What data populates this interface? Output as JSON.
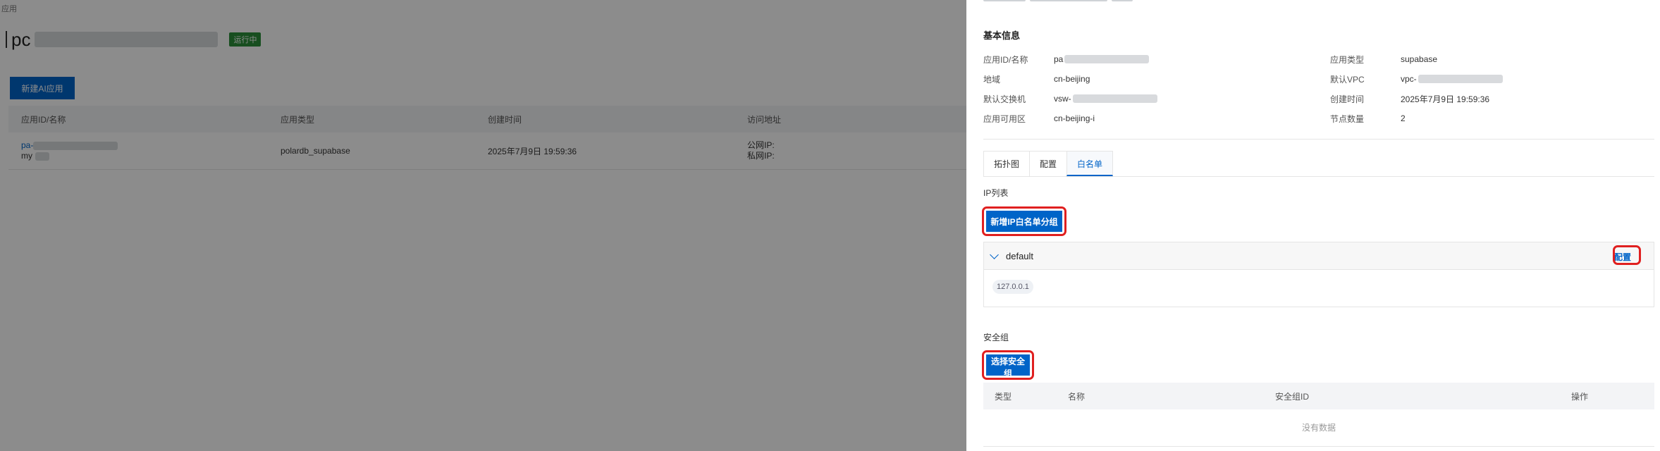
{
  "background": {
    "breadcrumb": "应用",
    "title_prefix": "pc",
    "status": "运行中",
    "create_button": "新建AI应用",
    "table": {
      "headers": [
        "应用ID/名称",
        "应用类型",
        "创建时间",
        "访问地址"
      ],
      "row": {
        "id": "pa-",
        "name": "my",
        "type": "polardb_supabase",
        "created": "2025年7月9日 19:59:36",
        "public_ip_label": "公网IP:",
        "private_ip_label": "私网IP:"
      }
    }
  },
  "drawer": {
    "basic_info_title": "基本信息",
    "info": {
      "id_label": "应用ID/名称",
      "id_value": "pa",
      "type_label": "应用类型",
      "type_value": "supabase",
      "region_label": "地域",
      "region_value": "cn-beijing",
      "vpc_label": "默认VPC",
      "vpc_value": "vpc-",
      "vswitch_label": "默认交换机",
      "vswitch_value": "vsw-",
      "created_label": "创建时间",
      "created_value": "2025年7月9日 19:59:36",
      "zone_label": "应用可用区",
      "zone_value": "cn-beijing-i",
      "nodes_label": "节点数量",
      "nodes_value": "2"
    },
    "tabs": [
      "拓扑图",
      "配置",
      "白名单"
    ],
    "active_tab": "白名单",
    "ip_list_label": "IP列表",
    "add_group_button": "新增IP白名单分组",
    "group": {
      "name": "default",
      "config_link": "配置",
      "ip": "127.0.0.1"
    },
    "security_group_label": "安全组",
    "select_sg_button": "选择安全组",
    "sg_table": {
      "headers": [
        "类型",
        "名称",
        "安全组ID",
        "操作"
      ],
      "empty": "没有数据"
    }
  },
  "colors": {
    "primary": "#0064c8",
    "status_green": "#2a8f3a",
    "highlight": "#e02020"
  }
}
